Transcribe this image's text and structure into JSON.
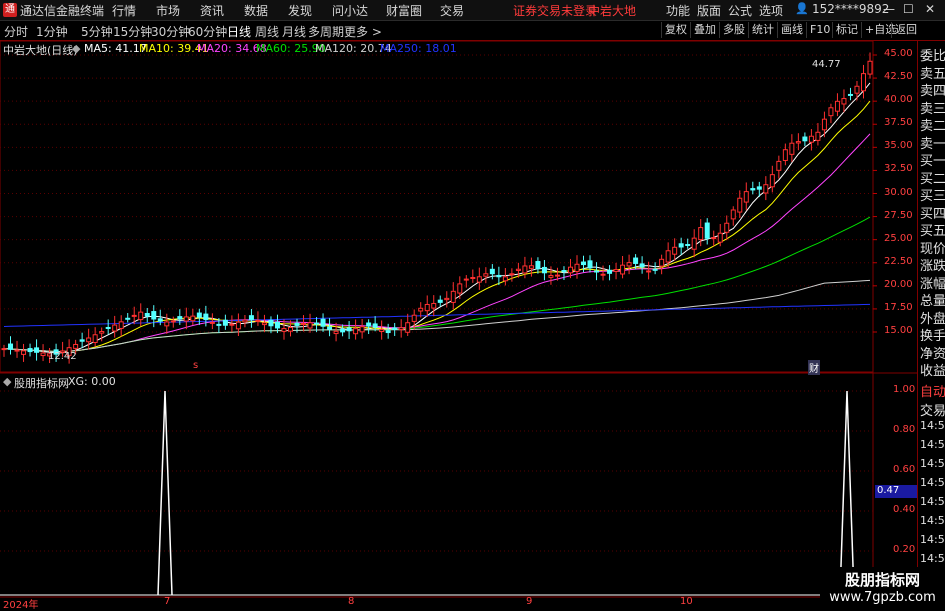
{
  "app": {
    "title": "通达信金融终端"
  },
  "menu": [
    "行情",
    "市场",
    "资讯",
    "数据",
    "发现",
    "问小达",
    "财富圈",
    "交易"
  ],
  "warning": "证券交易未登录",
  "stock_name_top": "中岩大地",
  "right_menu": [
    "功能",
    "版面",
    "公式",
    "选项"
  ],
  "user": "152****9892",
  "periods": [
    "分时",
    "1分钟",
    "5分钟",
    "15分钟",
    "30分钟",
    "60分钟",
    "日线",
    "周线",
    "月线",
    "多周期",
    "更多 >"
  ],
  "active_period": "日线",
  "tools": [
    "复权",
    "叠加",
    "多股",
    "统计",
    "画线",
    "F10",
    "标记",
    "+自选",
    "返回"
  ],
  "main_legend": {
    "title": "中岩大地(日线)",
    "ma": [
      {
        "label": "MA5: 41.17",
        "color": "#ffffff"
      },
      {
        "label": "MA10: 39.41",
        "color": "#ffff00"
      },
      {
        "label": "MA20: 34.68",
        "color": "#ff44ff"
      },
      {
        "label": "MA60: 25.90",
        "color": "#00e000"
      },
      {
        "label": "MA120: 20.74",
        "color": "#d0d0d0"
      },
      {
        "label": "MA250: 18.01",
        "color": "#2233ff"
      }
    ]
  },
  "sub_legend": {
    "title": "股朋指标网",
    "value": "XG: 0.00"
  },
  "price_axis": [
    "45.00",
    "42.50",
    "40.00",
    "37.50",
    "35.00",
    "32.50",
    "30.00",
    "27.50",
    "25.00",
    "22.50",
    "20.00",
    "17.50",
    "15.00"
  ],
  "sub_axis": [
    "1.00",
    "0.80",
    "0.60",
    "0.40",
    "0.20"
  ],
  "sub_cursor": "0.47",
  "high_label": "44.77",
  "low_label": "12.42",
  "markers": {
    "m1": "s",
    "m2": "财"
  },
  "x_ticks": [
    "2024年",
    "7",
    "8",
    "9",
    "10",
    "1"
  ],
  "right_panel": {
    "labels": [
      "委比",
      "卖五",
      "卖四",
      "卖三",
      "卖二",
      "卖一",
      "买一",
      "买二",
      "买三",
      "买四",
      "买五",
      "现价",
      "涨跌",
      "涨幅",
      "总量",
      "外盘",
      "换手",
      "净资",
      "收益"
    ],
    "lower": [
      "自动",
      "交易",
      "14:56",
      "14:56",
      "14:56",
      "14:56",
      "14:56",
      "14:56",
      "14:56",
      "14:56",
      "14:56"
    ]
  },
  "watermark": {
    "line1": "股朋指标网",
    "line2": "www.7gpzb.com"
  },
  "chart_data": {
    "type": "candlestick",
    "price_range": [
      12.42,
      44.77
    ],
    "signal_series": {
      "name": "XG",
      "peaks_at": [
        "7",
        "1"
      ],
      "value": 1.0
    }
  }
}
